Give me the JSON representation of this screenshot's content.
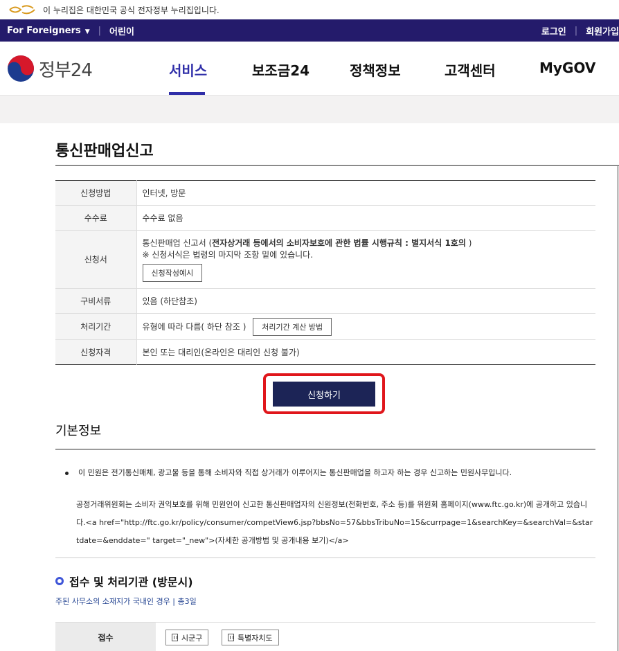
{
  "notice": {
    "text": "이 누리집은 대한민국 공식 전자정부 누리집입니다."
  },
  "utilbar": {
    "foreigners": "For Foreigners",
    "kids": "어린이",
    "login": "로그인",
    "signup": "회원가입"
  },
  "brand": {
    "name": "정부24"
  },
  "gnb": [
    "서비스",
    "보조금24",
    "정책정보",
    "고객센터",
    "MyGOV"
  ],
  "page": {
    "title": "통신판매업신고"
  },
  "info": {
    "rows": [
      {
        "label": "신청방법",
        "value": "인터넷, 방문"
      },
      {
        "label": "수수료",
        "value": "수수료 없음"
      },
      {
        "label": "신청서",
        "value_prefix": "통신판매업 신고서 (",
        "value_bold": "전자상거래 등에서의 소비자보호에 관한 법률 시행규칙 : 별지서식 1호의",
        "value_suffix": " )",
        "note": "※ 신청서식은 법령의 마지막 조항 밑에 있습니다.",
        "button": "신청작성예시"
      },
      {
        "label": "구비서류",
        "value": "있음 (하단참조)"
      },
      {
        "label": "처리기간",
        "value": "유형에 따라 다름( 하단 참조 )",
        "button": "처리기간 계산 방법"
      },
      {
        "label": "신청자격",
        "value": "본인 또는 대리인(온라인은 대리인 신청 불가)"
      }
    ]
  },
  "apply": {
    "label": "신청하기"
  },
  "basic": {
    "heading": "기본정보",
    "bullet": "이 민원은 전기통신매체, 광고물 등을 통해 소비자와 직접 상거래가 이루어지는 통신판매업을 하고자 하는 경우 신고하는 민원사무입니다.",
    "paragraph": "공정거래위원회는 소비자 권익보호를 위해 민원인이 신고한 통신판매업자의 신원정보(전화번호, 주소 등)를 위원회 홈페이지(www.ftc.go.kr)에 공개하고 있습니다.<a href=\"http://ftc.go.kr/policy/consumer/competView6.jsp?bbsNo=57&bbsTribuNo=15&currpage=1&searchKey=&searchVal=&startdate=&enddate=\" target=\"_new\">(자세한 공개방법 및 공개내용 보기)</a>"
  },
  "office": {
    "heading": "접수 및 처리기관 (방문시)",
    "sub": "주된 사무소의 소재지가 국내인 경우 | 총3일",
    "recv_label": "접수",
    "recv_buttons": [
      "시군구",
      "특별자치도"
    ]
  }
}
